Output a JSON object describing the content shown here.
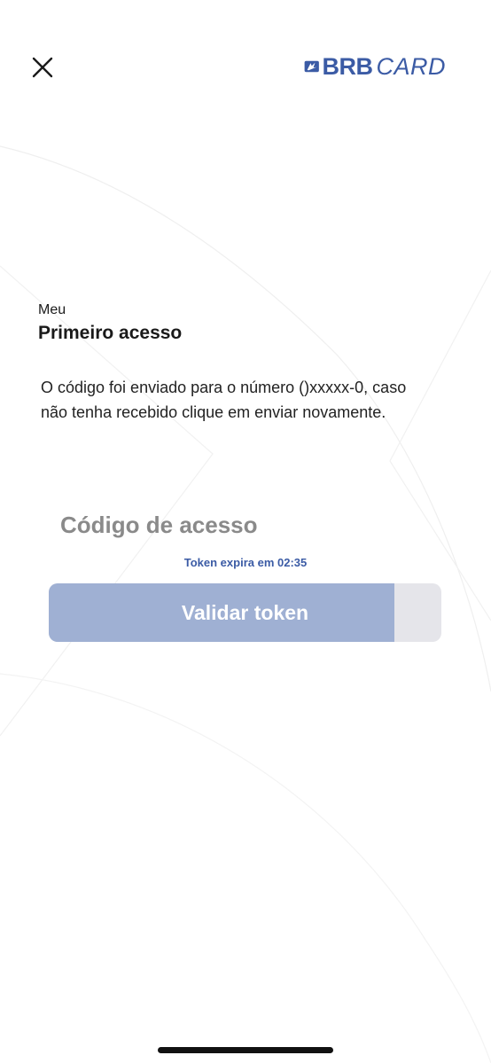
{
  "header": {
    "close_icon": "close-icon",
    "logo": {
      "brand_primary": "BRB",
      "brand_secondary": "CARD",
      "color": "#3b5ba5"
    }
  },
  "content": {
    "subtitle": "Meu",
    "title": "Primeiro acesso",
    "message": "O código foi enviado para o número ()xxxxx-0, caso não tenha recebido clique em enviar novamente.",
    "code_field": {
      "placeholder": "Código de acesso",
      "value": ""
    },
    "token_expiry": "Token expira em 02:35",
    "validate_button": {
      "label": "Validar token",
      "progress": 0.88
    }
  },
  "colors": {
    "accent": "#3b5ba5",
    "button_fill": "#9fb0d3",
    "button_track": "#e5e5ea"
  }
}
